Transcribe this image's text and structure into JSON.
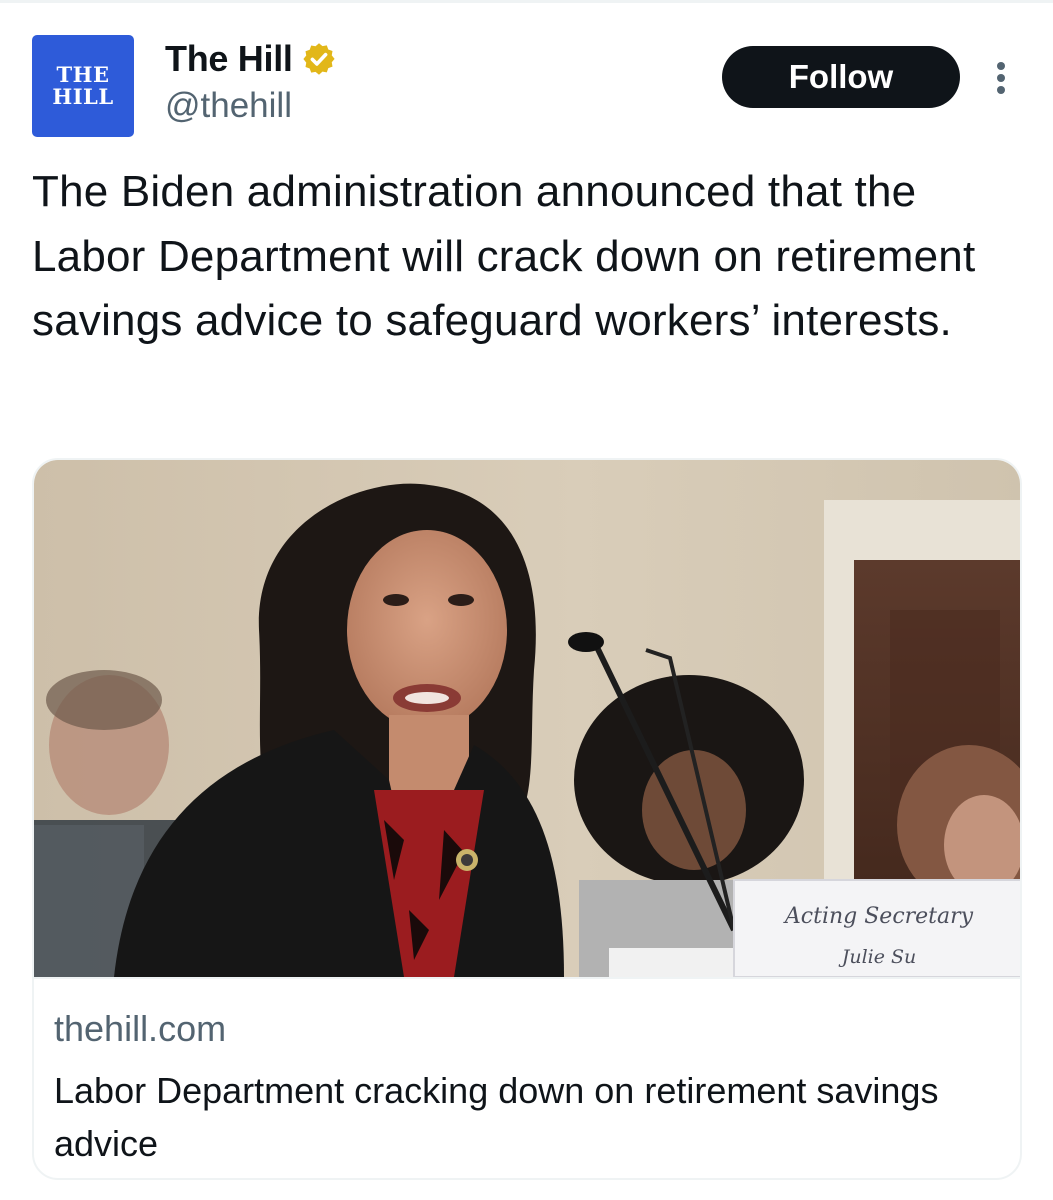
{
  "author": {
    "display_name": "The Hill",
    "handle": "@thehill",
    "avatar_line1": "THE",
    "avatar_line2": "HILL",
    "verified": true,
    "verified_badge_color": "#e2b719"
  },
  "actions": {
    "follow_label": "Follow",
    "more_icon": "more-vertical-icon"
  },
  "tweet": {
    "text": "The Biden administration announced that the Labor Department will crack down on retirement savings advice to safeguard workers’ interests."
  },
  "card": {
    "domain": "thehill.com",
    "title": "Labor Department cracking down on retirement savings advice",
    "image": {
      "placard_line1": "Acting Secretary",
      "placard_line2": "Julie Su"
    }
  },
  "colors": {
    "brand_blue": "#2e5bd9",
    "text_primary": "#0f1419",
    "text_secondary": "#536471",
    "border": "#eff3f4",
    "follow_bg": "#0f1419"
  }
}
